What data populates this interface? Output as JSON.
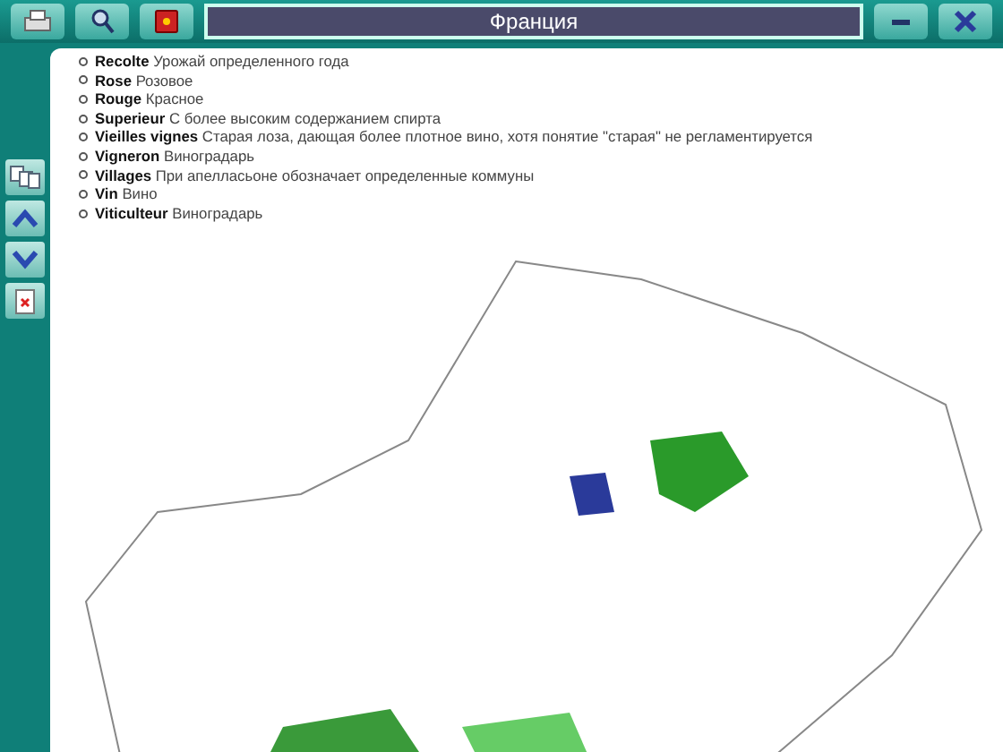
{
  "window": {
    "title": "Франция"
  },
  "glossary": [
    {
      "term": "Recolte",
      "definition": "Урожай определенного года"
    },
    {
      "term": "Rose",
      "definition": "Розовое"
    },
    {
      "term": "Rouge",
      "definition": "Красное"
    },
    {
      "term": "Superieur",
      "definition": "С более высоким содержанием спирта"
    },
    {
      "term": "Vieilles vignes",
      "definition": "Старая лоза, дающая более плотное вино, хотя понятие \"старая\" не регламентируется"
    },
    {
      "term": "Vigneron",
      "definition": "Виноградарь"
    },
    {
      "term": "Villages",
      "definition": "При апелласьоне обозначает определенные коммуны"
    },
    {
      "term": "Vin",
      "definition": "Вино"
    },
    {
      "term": "Viticulteur",
      "definition": "Виноградарь"
    }
  ]
}
